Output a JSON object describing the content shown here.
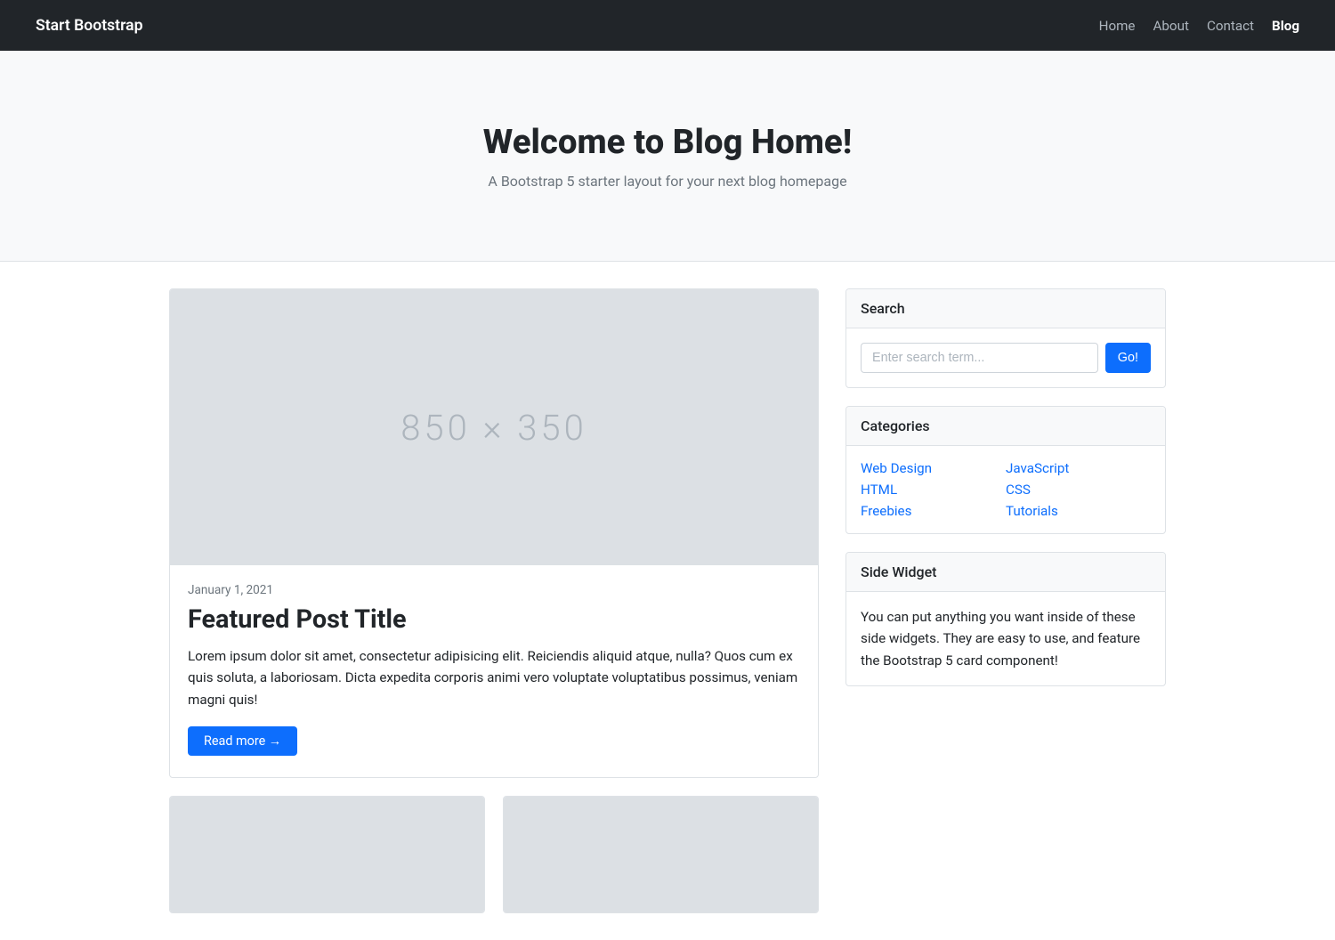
{
  "navbar": {
    "brand": "Start Bootstrap",
    "links": [
      {
        "label": "Home",
        "active": false
      },
      {
        "label": "About",
        "active": false
      },
      {
        "label": "Contact",
        "active": false
      },
      {
        "label": "Blog",
        "active": true
      }
    ]
  },
  "hero": {
    "title": "Welcome to Blog Home!",
    "subtitle": "A Bootstrap 5 starter layout for your next blog homepage"
  },
  "featured_post": {
    "image_label": "850 × 350",
    "date": "January 1, 2021",
    "title": "Featured Post Title",
    "text": "Lorem ipsum dolor sit amet, consectetur adipisicing elit. Reiciendis aliquid atque, nulla? Quos cum ex quis soluta, a laboriosam. Dicta expedita corporis animi vero voluptate voluptatibus possimus, veniam magni quis!",
    "read_more": "Read more →"
  },
  "sidebar": {
    "search": {
      "header": "Search",
      "placeholder": "Enter search term...",
      "button": "Go!"
    },
    "categories": {
      "header": "Categories",
      "items": [
        {
          "label": "Web Design"
        },
        {
          "label": "JavaScript"
        },
        {
          "label": "HTML"
        },
        {
          "label": "CSS"
        },
        {
          "label": "Freebies"
        },
        {
          "label": "Tutorials"
        }
      ]
    },
    "side_widget": {
      "header": "Side Widget",
      "text": "You can put anything you want inside of these side widgets. They are easy to use, and feature the Bootstrap 5 card component!"
    }
  }
}
